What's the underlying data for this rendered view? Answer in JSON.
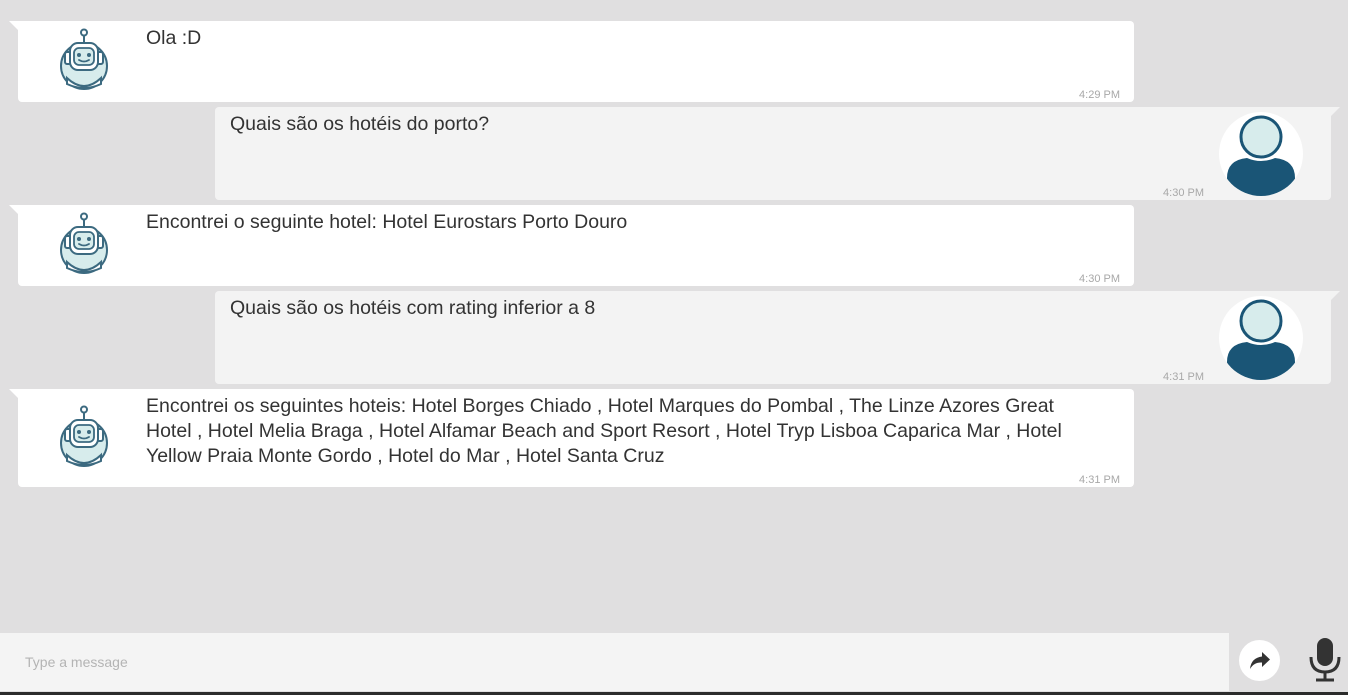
{
  "messages": [
    {
      "sender": "bot",
      "text": "Ola :D",
      "time": "4:29 PM"
    },
    {
      "sender": "user",
      "text": "Quais são os hotéis do porto?",
      "time": "4:30 PM"
    },
    {
      "sender": "bot",
      "text": "Encontrei o seguinte hotel: Hotel Eurostars Porto Douro",
      "time": "4:30 PM"
    },
    {
      "sender": "user",
      "text": "Quais são os hotéis com rating inferior a 8",
      "time": "4:31 PM"
    },
    {
      "sender": "bot",
      "text": "Encontrei os seguintes hoteis: Hotel Borges Chiado , Hotel Marques do Pombal , The Linze Azores Great Hotel , Hotel Melia Braga , Hotel Alfamar Beach and Sport Resort , Hotel Tryp Lisboa Caparica Mar , Hotel Yellow Praia Monte Gordo , Hotel do Mar , Hotel Santa Cruz",
      "time": "4:31 PM"
    }
  ],
  "composer": {
    "placeholder": "Type a message",
    "value": ""
  },
  "icons": {
    "bot_avatar": "robot-icon",
    "user_avatar": "user-icon",
    "send": "share-arrow-icon",
    "mic": "microphone-icon"
  },
  "colors": {
    "background": "#e0dfe0",
    "bot_bubble": "#ffffff",
    "user_bubble": "#f3f3f3",
    "avatar_dark": "#1a5576",
    "avatar_light": "#d7ecec"
  }
}
